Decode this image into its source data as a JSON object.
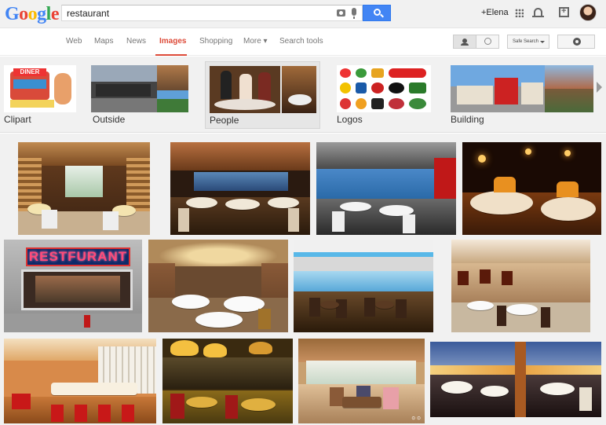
{
  "logo": {
    "letters": [
      {
        "ch": "G",
        "color": "#4285f4"
      },
      {
        "ch": "o",
        "color": "#ea4335"
      },
      {
        "ch": "o",
        "color": "#fbbc05"
      },
      {
        "ch": "g",
        "color": "#4285f4"
      },
      {
        "ch": "l",
        "color": "#34a853"
      },
      {
        "ch": "e",
        "color": "#ea4335"
      }
    ]
  },
  "search": {
    "value": "restaurant"
  },
  "user": {
    "name": "+Elena"
  },
  "nav": {
    "tabs": [
      "Web",
      "Maps",
      "News",
      "Images",
      "Shopping",
      "More ▾",
      "Search tools"
    ],
    "active": "Images"
  },
  "safe_search": {
    "label": "Safe Search"
  },
  "related": [
    {
      "label": "Clipart"
    },
    {
      "label": "Outside"
    },
    {
      "label": "People"
    },
    {
      "label": "Logos"
    },
    {
      "label": "Building"
    }
  ],
  "colors": {
    "accent": "#dd4b39",
    "search_blue": "#4285f4"
  },
  "storefront_sign": "RESTFURANT"
}
